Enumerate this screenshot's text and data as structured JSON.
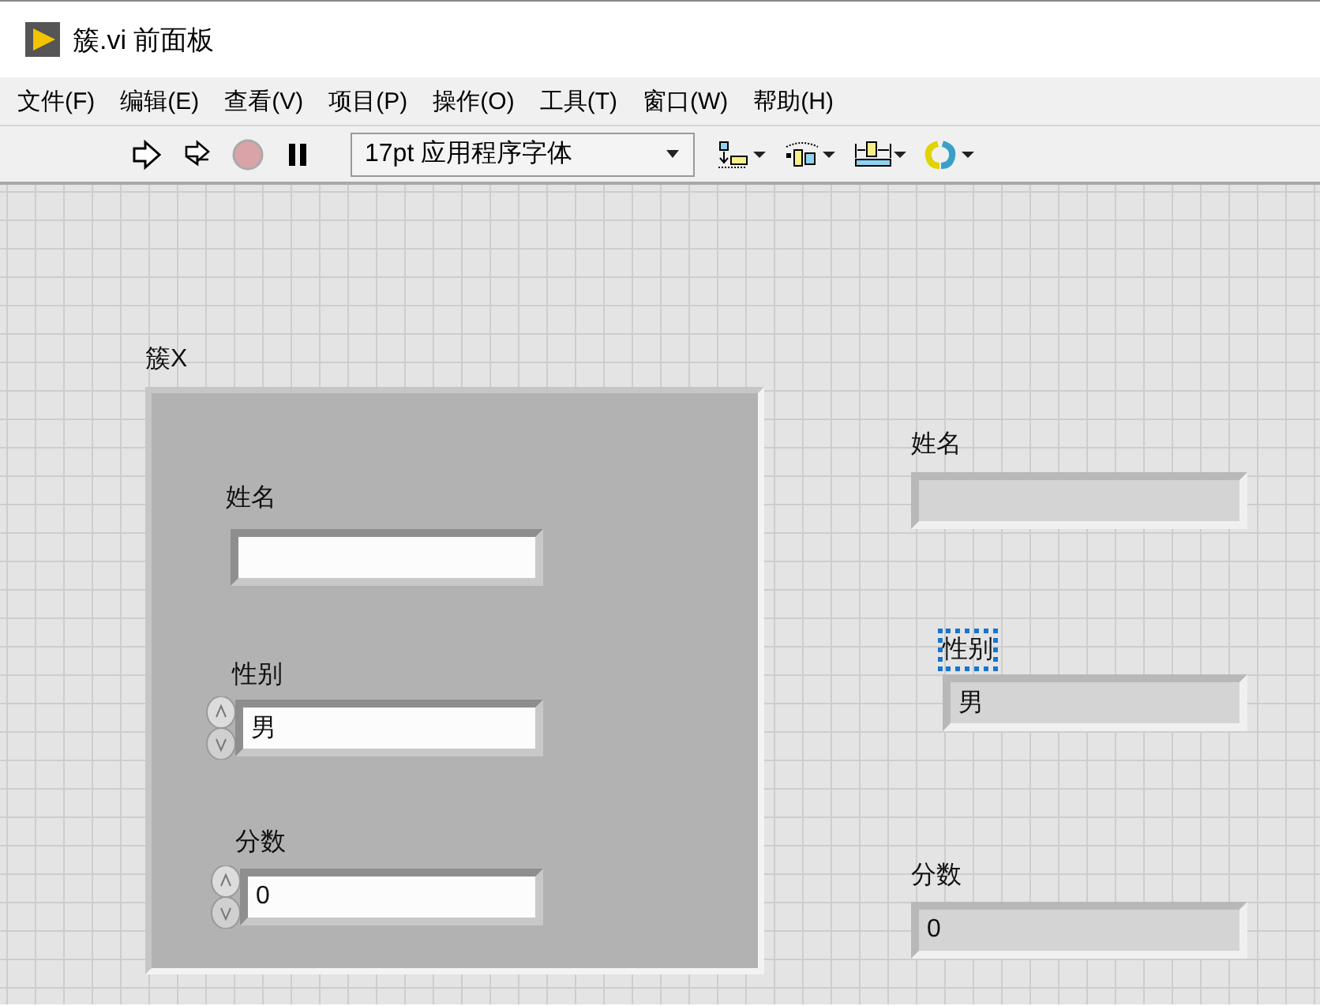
{
  "window": {
    "title": "簇.vi 前面板"
  },
  "menu": [
    "文件(F)",
    "编辑(E)",
    "查看(V)",
    "项目(P)",
    "操作(O)",
    "工具(T)",
    "窗口(W)",
    "帮助(H)"
  ],
  "toolbar": {
    "font": "17pt 应用程序字体"
  },
  "cluster": {
    "label": "簇X",
    "controls": [
      {
        "kind": "string",
        "label": "姓名"
      },
      {
        "kind": "ring",
        "label": "性别",
        "value": "男"
      },
      {
        "kind": "numeric",
        "label": "分数",
        "value": "0"
      }
    ]
  },
  "indicators": [
    {
      "label": "姓名",
      "selected": false
    },
    {
      "label": "性别",
      "value": "男",
      "selected": true
    },
    {
      "label": "分数",
      "value": "0",
      "selected": false
    }
  ]
}
